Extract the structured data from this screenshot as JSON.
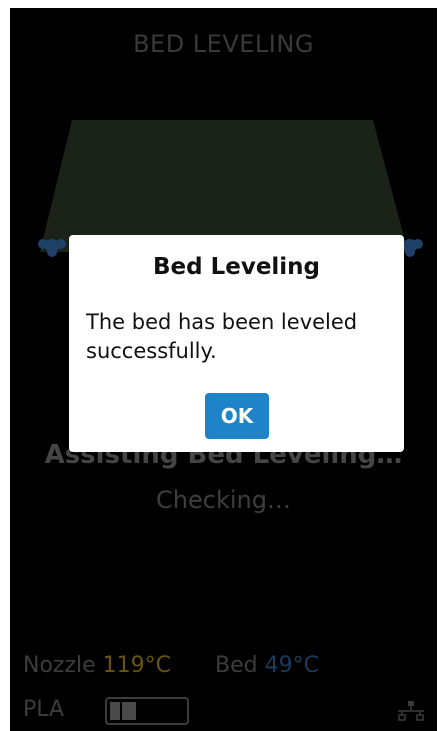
{
  "screen": {
    "title": "BED LEVELING",
    "assist_text": "Assisting Bed Leveling…",
    "status_text": "Checking…"
  },
  "status_bar": {
    "nozzle_label": "Nozzle",
    "nozzle_temp": "119°C",
    "bed_label": "Bed",
    "bed_temp": "49°C",
    "filament_label": "PLA",
    "filament_level": 0.35,
    "network_icon": "network-icon"
  },
  "dialog": {
    "title": "Bed Leveling",
    "message": "The bed has been leveled successfully.",
    "ok_label": "OK"
  },
  "colors": {
    "screen_bg": "#000000",
    "dialog_bg": "#ffffff",
    "accent": "#1f84c7",
    "nozzle_temp": "#6a5410",
    "bed_temp": "#1d3b5d",
    "bed_plate": "#1b2319",
    "knob": "#1f4168"
  }
}
